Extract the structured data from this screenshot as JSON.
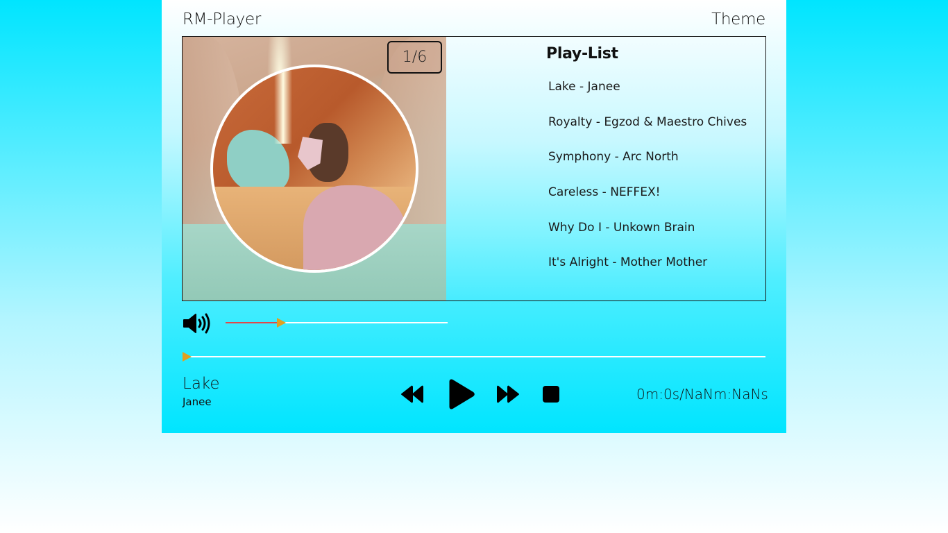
{
  "header": {
    "app_title": "RM-Player",
    "theme_label": "Theme"
  },
  "cover": {
    "track_counter": "1/6",
    "current_index": 1,
    "total_tracks": 6
  },
  "playlist": {
    "title": "Play-List",
    "items": [
      {
        "label": "Lake - Janee"
      },
      {
        "label": "Royalty - Egzod & Maestro Chives"
      },
      {
        "label": "Symphony - Arc North"
      },
      {
        "label": "Careless - NEFFEX!"
      },
      {
        "label": "Why Do I - Unkown Brain"
      },
      {
        "label": "It's Alright - Mother Mother"
      }
    ]
  },
  "volume": {
    "icon": "speaker-volume-icon",
    "level": 0.23,
    "fill_color": "#e04848",
    "thumb_color": "#e0a020"
  },
  "progress": {
    "value": 0,
    "thumb_color": "#e0a020"
  },
  "now_playing": {
    "title": "Lake",
    "artist": "Janee"
  },
  "controls": {
    "previous_icon": "rewind-icon",
    "play_icon": "play-icon",
    "next_icon": "fast-forward-icon",
    "stop_icon": "stop-icon"
  },
  "time": {
    "display": "0m:0s/NaNm:NaNs"
  },
  "colors": {
    "accent_cyan": "#00e5ff",
    "text": "#111111"
  }
}
